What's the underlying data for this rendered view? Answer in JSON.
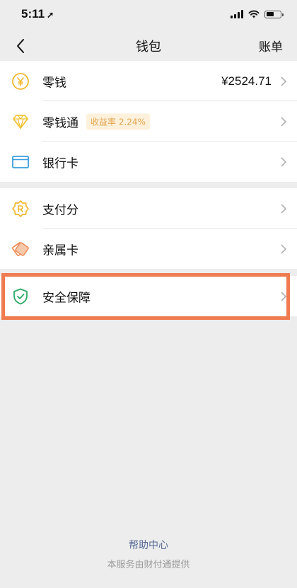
{
  "status_bar": {
    "time": "5:11",
    "location_arrow": "➚",
    "battery_level": 0.6
  },
  "nav": {
    "title": "钱包",
    "right_label": "账单",
    "back_icon": "chevron-left-icon"
  },
  "items": [
    {
      "label": "零钱",
      "value": "¥2524.71",
      "icon": "yuan-coin-icon"
    },
    {
      "label": "零钱通",
      "badge": "收益率 2.24%",
      "icon": "diamond-icon"
    },
    {
      "label": "银行卡",
      "icon": "bank-card-icon"
    },
    {
      "label": "支付分",
      "icon": "credit-score-icon"
    },
    {
      "label": "亲属卡",
      "icon": "family-card-icon"
    },
    {
      "label": "安全保障",
      "icon": "shield-check-icon"
    }
  ],
  "footer": {
    "help_link": "帮助中心",
    "provider_note": "本服务由财付通提供"
  },
  "colors": {
    "background": "#ededed",
    "highlight_border": "#f07b4e",
    "badge_text": "#e4a44c",
    "link": "#576b95"
  }
}
